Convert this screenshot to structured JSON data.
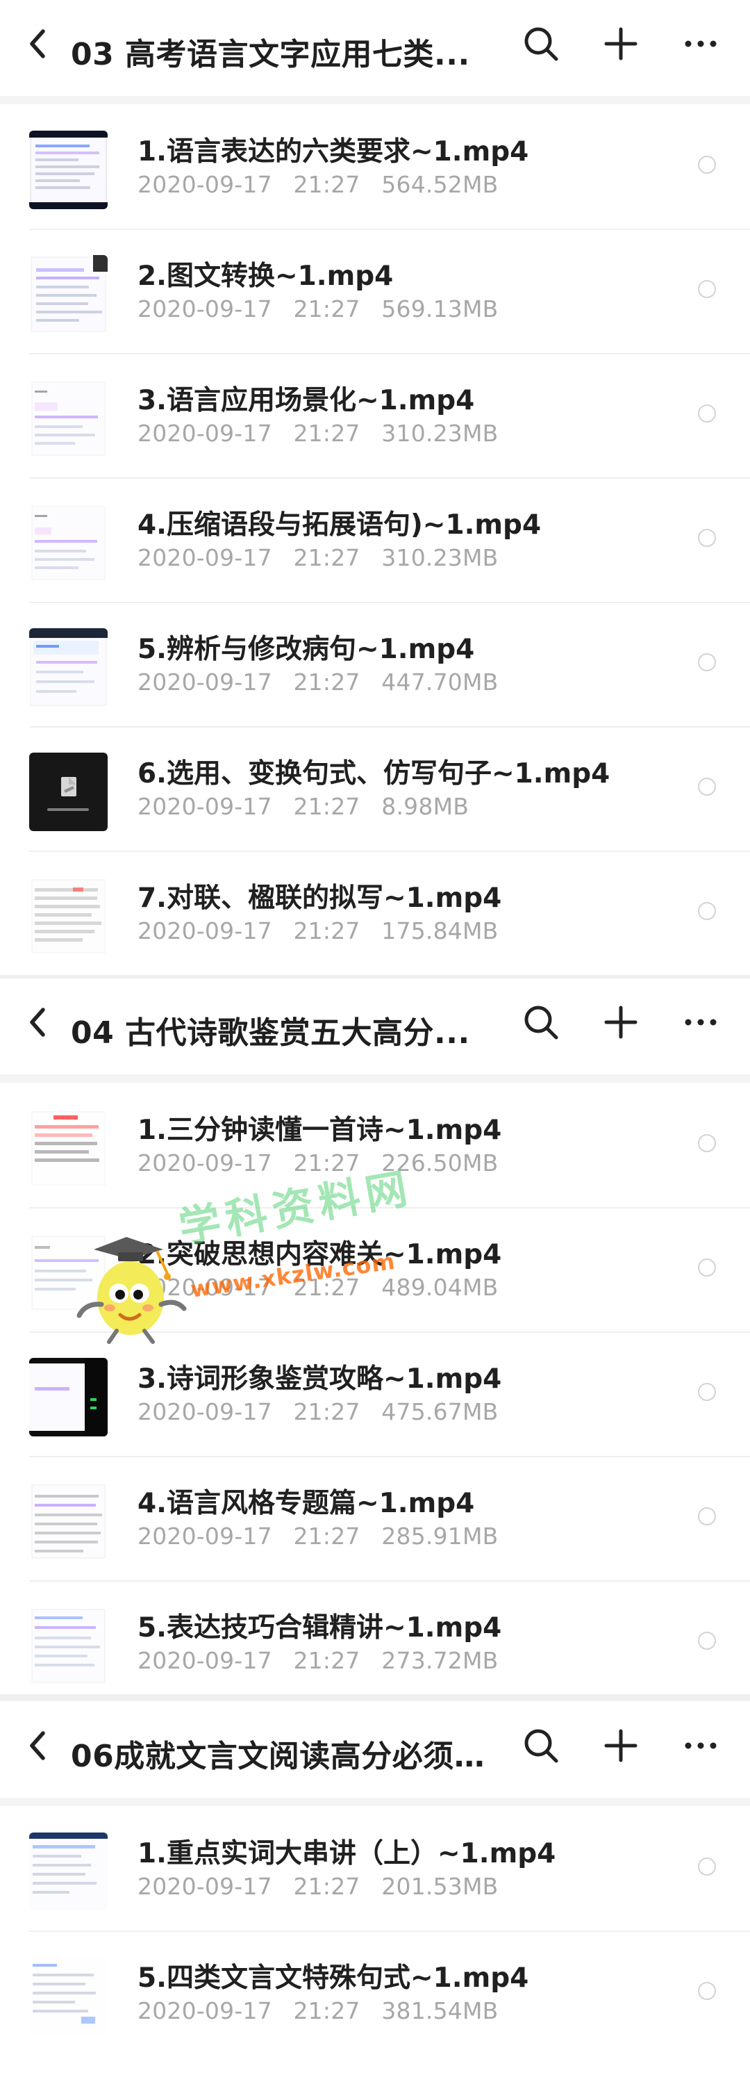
{
  "sections": [
    {
      "header": {
        "title": "03 高考语言文字应用七类..."
      },
      "items": [
        {
          "name": "1.语言表达的六类要求~1.mp4",
          "date": "2020-09-17",
          "time": "21:27",
          "size": "564.52MB",
          "thumbnail": "document-video-thumb"
        },
        {
          "name": "2.图文转换~1.mp4",
          "date": "2020-09-17",
          "time": "21:27",
          "size": "569.13MB",
          "thumbnail": "document-video-thumb"
        },
        {
          "name": "3.语言应用场景化~1.mp4",
          "date": "2020-09-17",
          "time": "21:27",
          "size": "310.23MB",
          "thumbnail": "document-video-thumb"
        },
        {
          "name": "4.压缩语段与拓展语句)~1.mp4",
          "date": "2020-09-17",
          "time": "21:27",
          "size": "310.23MB",
          "thumbnail": "document-video-thumb"
        },
        {
          "name": "5.辨析与修改病句~1.mp4",
          "date": "2020-09-17",
          "time": "21:27",
          "size": "447.70MB",
          "thumbnail": "document-video-thumb"
        },
        {
          "name": "6.选用、变换句式、仿写句子~1.mp4",
          "date": "2020-09-17",
          "time": "21:27",
          "size": "8.98MB",
          "thumbnail": "dark-video-thumb"
        },
        {
          "name": "7.对联、楹联的拟写~1.mp4",
          "date": "2020-09-17",
          "time": "21:27",
          "size": "175.84MB",
          "thumbnail": "document-video-thumb"
        }
      ]
    },
    {
      "header": {
        "title": "04 古代诗歌鉴赏五大高分..."
      },
      "items": [
        {
          "name": "1.三分钟读懂一首诗~1.mp4",
          "date": "2020-09-17",
          "time": "21:27",
          "size": "226.50MB",
          "thumbnail": "document-video-thumb"
        },
        {
          "name": "2.突破思想内容难关~1.mp4",
          "date": "2020-09-17",
          "time": "21:27",
          "size": "489.04MB",
          "thumbnail": "document-video-thumb"
        },
        {
          "name": "3.诗词形象鉴赏攻略~1.mp4",
          "date": "2020-09-17",
          "time": "21:27",
          "size": "475.67MB",
          "thumbnail": "dark-video-thumb"
        },
        {
          "name": "4.语言风格专题篇~1.mp4",
          "date": "2020-09-17",
          "time": "21:27",
          "size": "285.91MB",
          "thumbnail": "document-video-thumb"
        },
        {
          "name": "5.表达技巧合辑精讲~1.mp4",
          "date": "2020-09-17",
          "time": "21:27",
          "size": "273.72MB",
          "thumbnail": "document-video-thumb"
        }
      ]
    },
    {
      "header": {
        "title": "06成就文言文阅读高分必须..."
      },
      "items": [
        {
          "name": "1.重点实词大串讲（上）~1.mp4",
          "date": "2020-09-17",
          "time": "21:27",
          "size": "201.53MB",
          "thumbnail": "document-video-thumb"
        },
        {
          "name": "5.四类文言文特殊句式~1.mp4",
          "date": "2020-09-17",
          "time": "21:27",
          "size": "381.54MB",
          "thumbnail": "document-video-thumb"
        }
      ]
    }
  ],
  "watermark": {
    "text": "学科资料网",
    "url": "www.xkzlw.com"
  },
  "colors": {
    "background": "#f2f2f2",
    "row": "#ffffff",
    "divider": "#efefef",
    "title": "#1f1f1f",
    "meta": "#a7a7a7",
    "watermark_text": "#5ad179",
    "watermark_url": "#ff6500"
  },
  "icons": {
    "back": "chevron-left-icon",
    "search": "search-icon",
    "add": "plus-icon",
    "more": "more-horizontal-icon",
    "select": "radio-circle-icon"
  }
}
